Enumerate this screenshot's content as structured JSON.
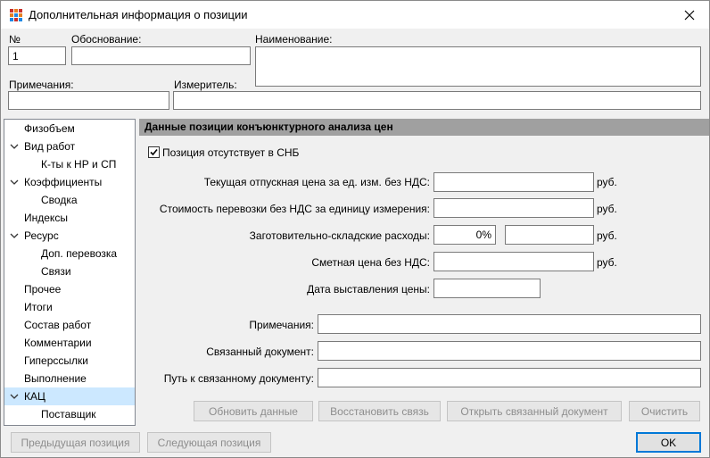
{
  "window": {
    "title": "Дополнительная информация о позиции"
  },
  "header_fields": {
    "number_label": "№",
    "number_value": "1",
    "basis_label": "Обоснование:",
    "basis_value": "",
    "name_label": "Наименование:",
    "name_value": "",
    "notes_label": "Примечания:",
    "notes_value": "",
    "unit_label": "Измеритель:",
    "unit_value": ""
  },
  "nav": {
    "items": [
      {
        "label": "Физобъем",
        "expandable": false,
        "level": 0
      },
      {
        "label": "Вид работ",
        "expandable": true,
        "level": 0
      },
      {
        "label": "К-ты к НР и СП",
        "expandable": false,
        "level": 1
      },
      {
        "label": "Коэффициенты",
        "expandable": true,
        "level": 0
      },
      {
        "label": "Сводка",
        "expandable": false,
        "level": 1
      },
      {
        "label": "Индексы",
        "expandable": false,
        "level": 0
      },
      {
        "label": "Ресурс",
        "expandable": true,
        "level": 0
      },
      {
        "label": "Доп. перевозка",
        "expandable": false,
        "level": 1
      },
      {
        "label": "Связи",
        "expandable": false,
        "level": 1
      },
      {
        "label": "Прочее",
        "expandable": false,
        "level": 0
      },
      {
        "label": "Итоги",
        "expandable": false,
        "level": 0
      },
      {
        "label": "Состав работ",
        "expandable": false,
        "level": 0
      },
      {
        "label": "Комментарии",
        "expandable": false,
        "level": 0
      },
      {
        "label": "Гиперссылки",
        "expandable": false,
        "level": 0
      },
      {
        "label": "Выполнение",
        "expandable": false,
        "level": 0
      },
      {
        "label": "КАЦ",
        "expandable": true,
        "level": 0,
        "selected": true
      },
      {
        "label": "Поставщик",
        "expandable": false,
        "level": 1
      }
    ]
  },
  "kac_panel": {
    "header": "Данные позиции конъюнктурного анализа цен",
    "missing_checkbox_label": "Позиция отсутствует в СНБ",
    "missing_checkbox_checked": true,
    "current_price_label": "Текущая отпускная цена за ед. изм. без НДС:",
    "current_price_value": "",
    "current_price_unit": "руб.",
    "transport_label": "Стоимость перевозки без НДС за единицу измерения:",
    "transport_value": "",
    "transport_unit": "руб.",
    "storage_label": "Заготовительно-складские расходы:",
    "storage_percent": "0%",
    "storage_value": "",
    "storage_unit": "руб.",
    "estimate_label": "Сметная цена без НДС:",
    "estimate_value": "",
    "estimate_unit": "руб.",
    "date_label": "Дата выставления цены:",
    "date_value": "",
    "notes_label": "Примечания:",
    "notes_value": "",
    "linked_doc_label": "Связанный документ:",
    "linked_doc_value": "",
    "linked_path_label": "Путь к связанному документу:",
    "linked_path_value": "",
    "buttons": {
      "update": "Обновить данные",
      "restore": "Восстановить связь",
      "open_doc": "Открыть связанный документ",
      "clear": "Очистить"
    }
  },
  "footer": {
    "prev": "Предыдущая позиция",
    "next": "Следующая позиция",
    "ok": "OK"
  },
  "colors": {
    "selection": "#cce8ff",
    "section_header": "#a0a0a0",
    "default_button_border": "#0078d7"
  }
}
